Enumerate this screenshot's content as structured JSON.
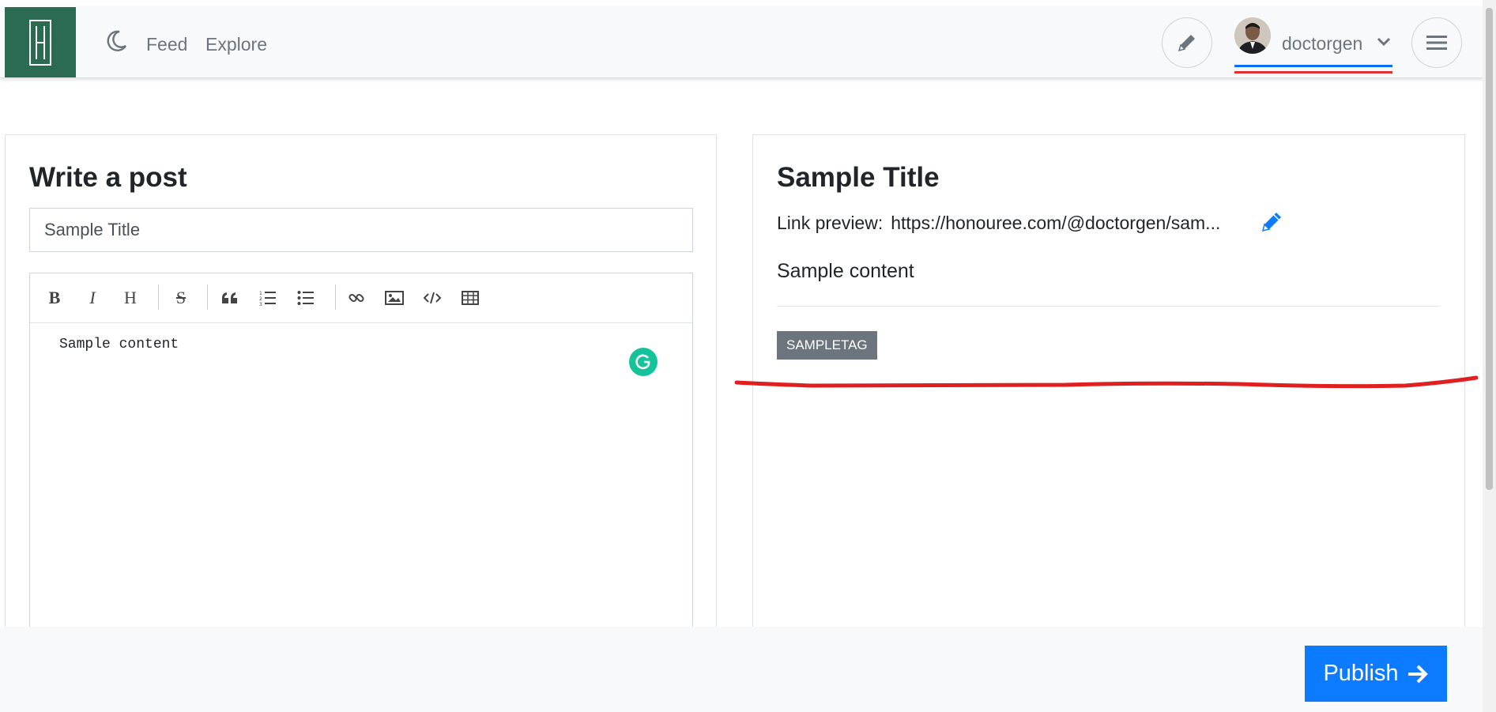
{
  "nav": {
    "feed": "Feed",
    "explore": "Explore",
    "username": "doctorgen"
  },
  "editor": {
    "heading": "Write a post",
    "title_value": "Sample Title",
    "content": "Sample content",
    "toolbar": [
      "bold",
      "italic",
      "heading",
      "strikethrough",
      "quote",
      "ordered-list",
      "unordered-list",
      "link",
      "image",
      "code",
      "table"
    ]
  },
  "preview": {
    "title": "Sample Title",
    "link_label": "Link preview:",
    "link_url": "https://honouree.com/@doctorgen/sam...",
    "content": "Sample content",
    "tag": "SAMPLETAG"
  },
  "footer": {
    "publish_label": "Publish"
  },
  "colors": {
    "brand": "#2a6b52",
    "accent": "#0d7bff",
    "annotation": "#e02020",
    "tag": "#6c757d"
  }
}
